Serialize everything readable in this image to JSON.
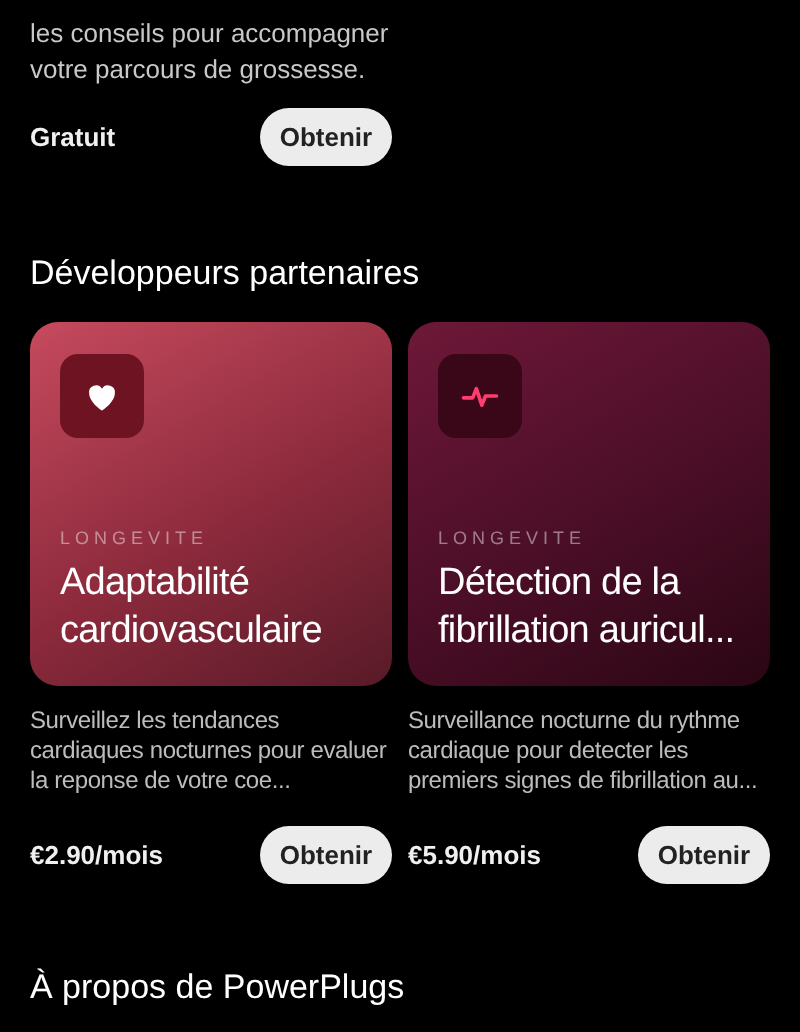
{
  "intro": {
    "text": "les conseils pour accompagner votre parcours de grossesse.",
    "price": "Gratuit",
    "button": "Obtenir"
  },
  "partners": {
    "heading": "Développeurs partenaires",
    "cards": [
      {
        "kind": "heart",
        "category": "LONGEVITE",
        "title": "Adaptabilité cardiovasculaire",
        "description": "Surveillez les tendances cardiaques nocturnes pour evaluer la reponse de votre coe...",
        "price": "€2.90/mois",
        "button": "Obtenir"
      },
      {
        "kind": "pulse",
        "category": "LONGEVITE",
        "title": "Détection de la fibrillation auricul...",
        "description": "Surveillance nocturne du rythme cardiaque pour detecter les premiers signes de fibrillation au...",
        "price": "€5.90/mois",
        "button": "Obtenir"
      }
    ]
  },
  "about": {
    "heading": "À propos de PowerPlugs"
  }
}
